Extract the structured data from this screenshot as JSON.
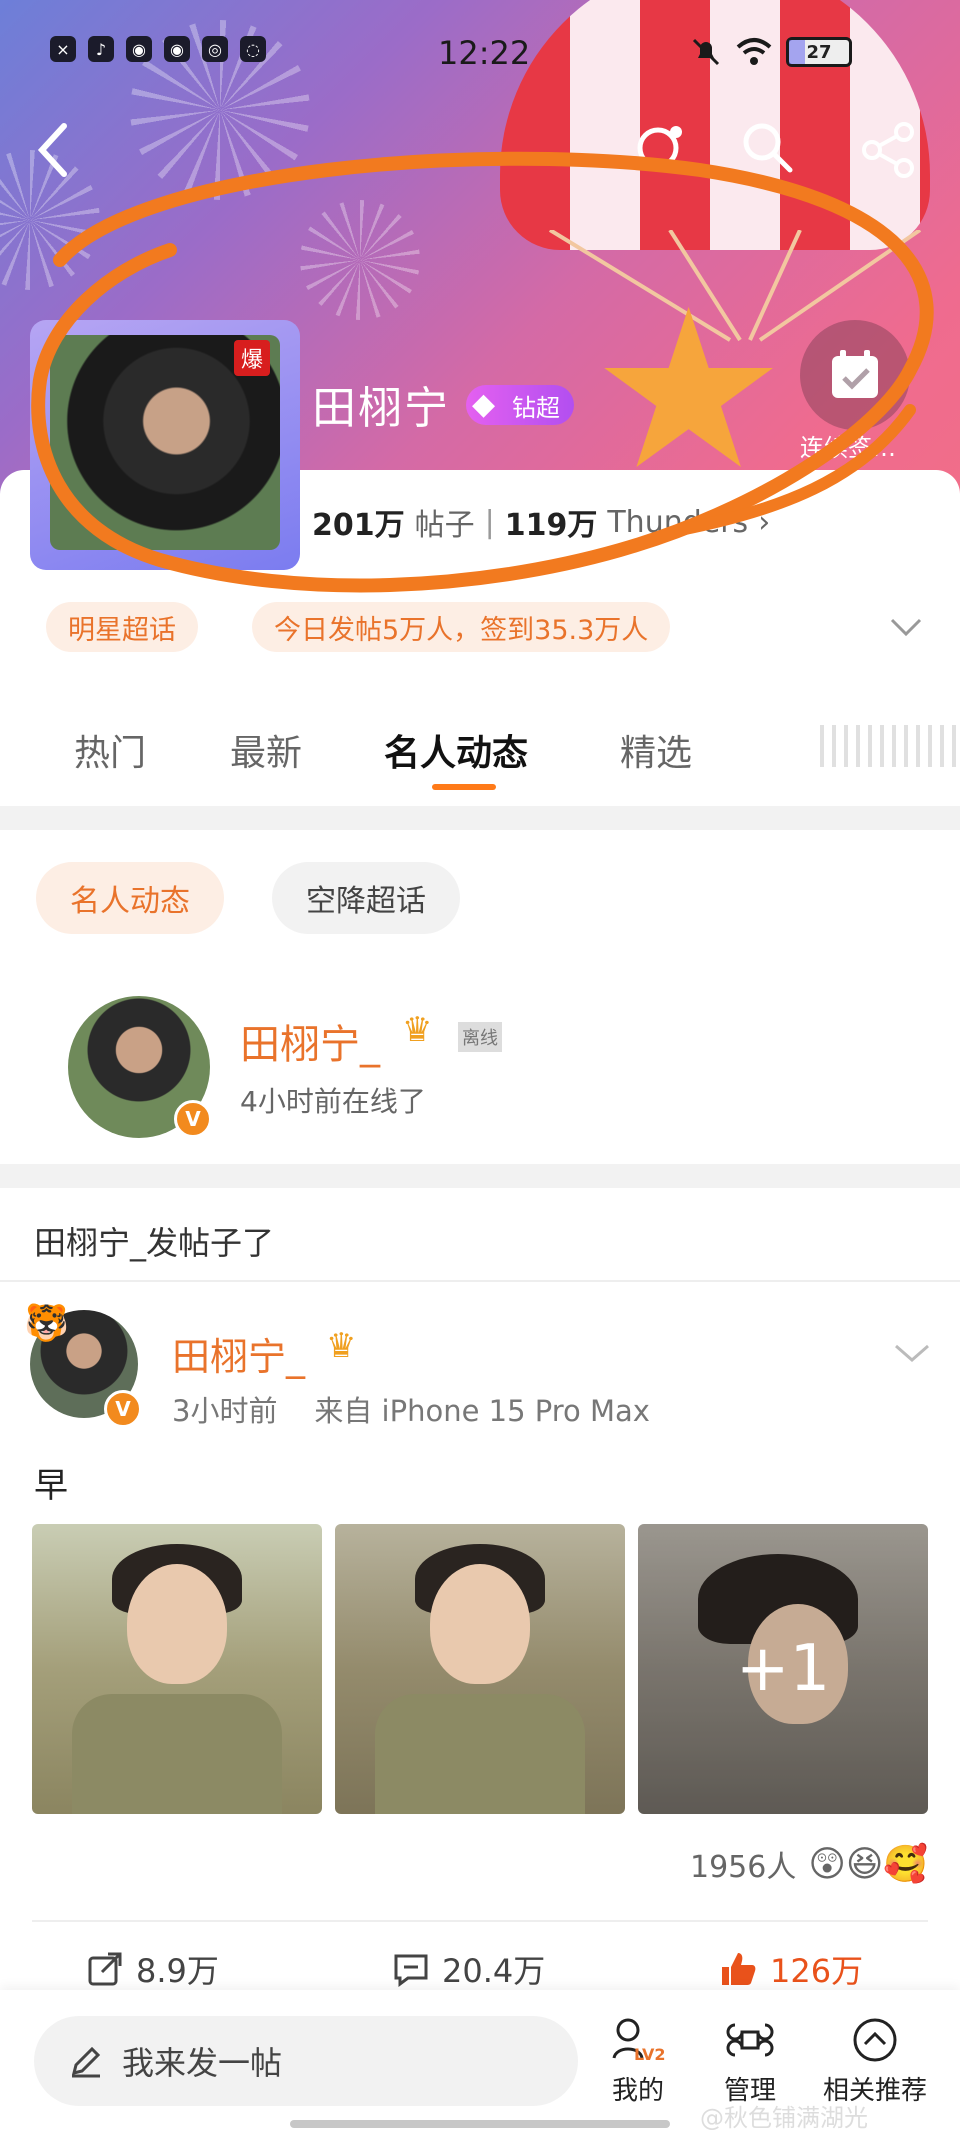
{
  "status_bar": {
    "time": "12:22",
    "battery": "27"
  },
  "topic": {
    "name": "田栩宁",
    "tier_badge": "钻超",
    "hot_mark": "爆",
    "sign_in": "连续签…",
    "posts_count": "201万",
    "posts_label": "帖子",
    "followers_count": "119万",
    "followers_label": "Thunders",
    "category_chip": "明星超话",
    "daily_stats": "今日发帖5万人，签到35.3万人"
  },
  "tabs": [
    "热门",
    "最新",
    "名人动态",
    "精选"
  ],
  "sub_tabs": [
    "名人动态",
    "空降超话"
  ],
  "celebrity": {
    "name": "田栩宁_",
    "status_tag": "离线",
    "last_online": "4小时前在线了",
    "verify": "V"
  },
  "section_title": "田栩宁_发帖子了",
  "post": {
    "author": "田栩宁_",
    "time": "3小时前",
    "source": "来自 iPhone 15 Pro Max",
    "text": "早",
    "more_images": "+1",
    "reaction_count": "1956人",
    "shares": "8.9万",
    "comments": "20.4万",
    "likes": "126万"
  },
  "bottom_nav": {
    "compose_placeholder": "我来发一帖",
    "mine": "我的",
    "level": "LV2",
    "manage": "管理",
    "related": "相关推荐"
  },
  "watermark": "@秋色铺满湖光",
  "colors": {
    "accent": "#e9732b",
    "like": "#e9521b"
  }
}
